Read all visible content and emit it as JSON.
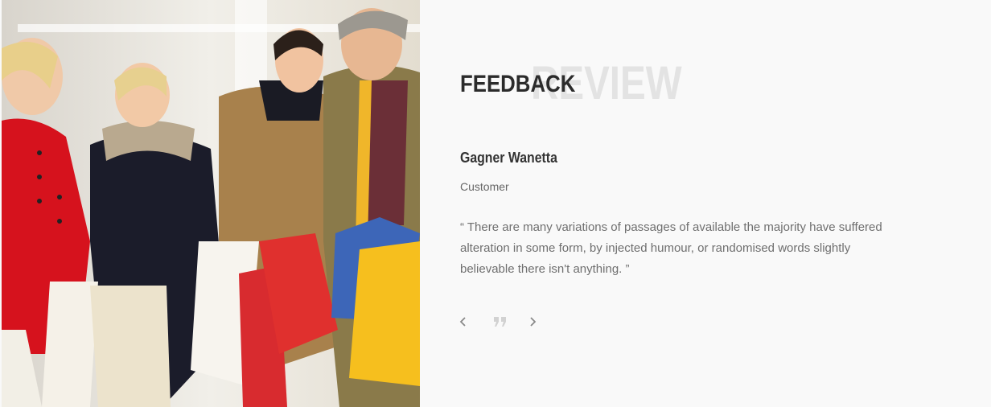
{
  "section": {
    "watermark": "REVIEW",
    "title": "FEEDBACK"
  },
  "testimonial": {
    "name": "Gagner Wanetta",
    "role": "Customer",
    "quote": "“ There are many variations of passages of available the majority have suffered alteration in some form, by injected humour, or randomised words slightly believable there isn't anything. ”"
  },
  "controls": {
    "prev_icon": "chevron-left-icon",
    "quote_icon": "quote-icon",
    "next_icon": "chevron-right-icon"
  },
  "colors": {
    "background": "#f9f9f9",
    "title": "#2b2b2b",
    "watermark": "#e3e3e3",
    "text": "#6f6f6f",
    "icon": "#b0b0b0"
  },
  "image": {
    "subject": "shoppers-with-bags-photo"
  }
}
